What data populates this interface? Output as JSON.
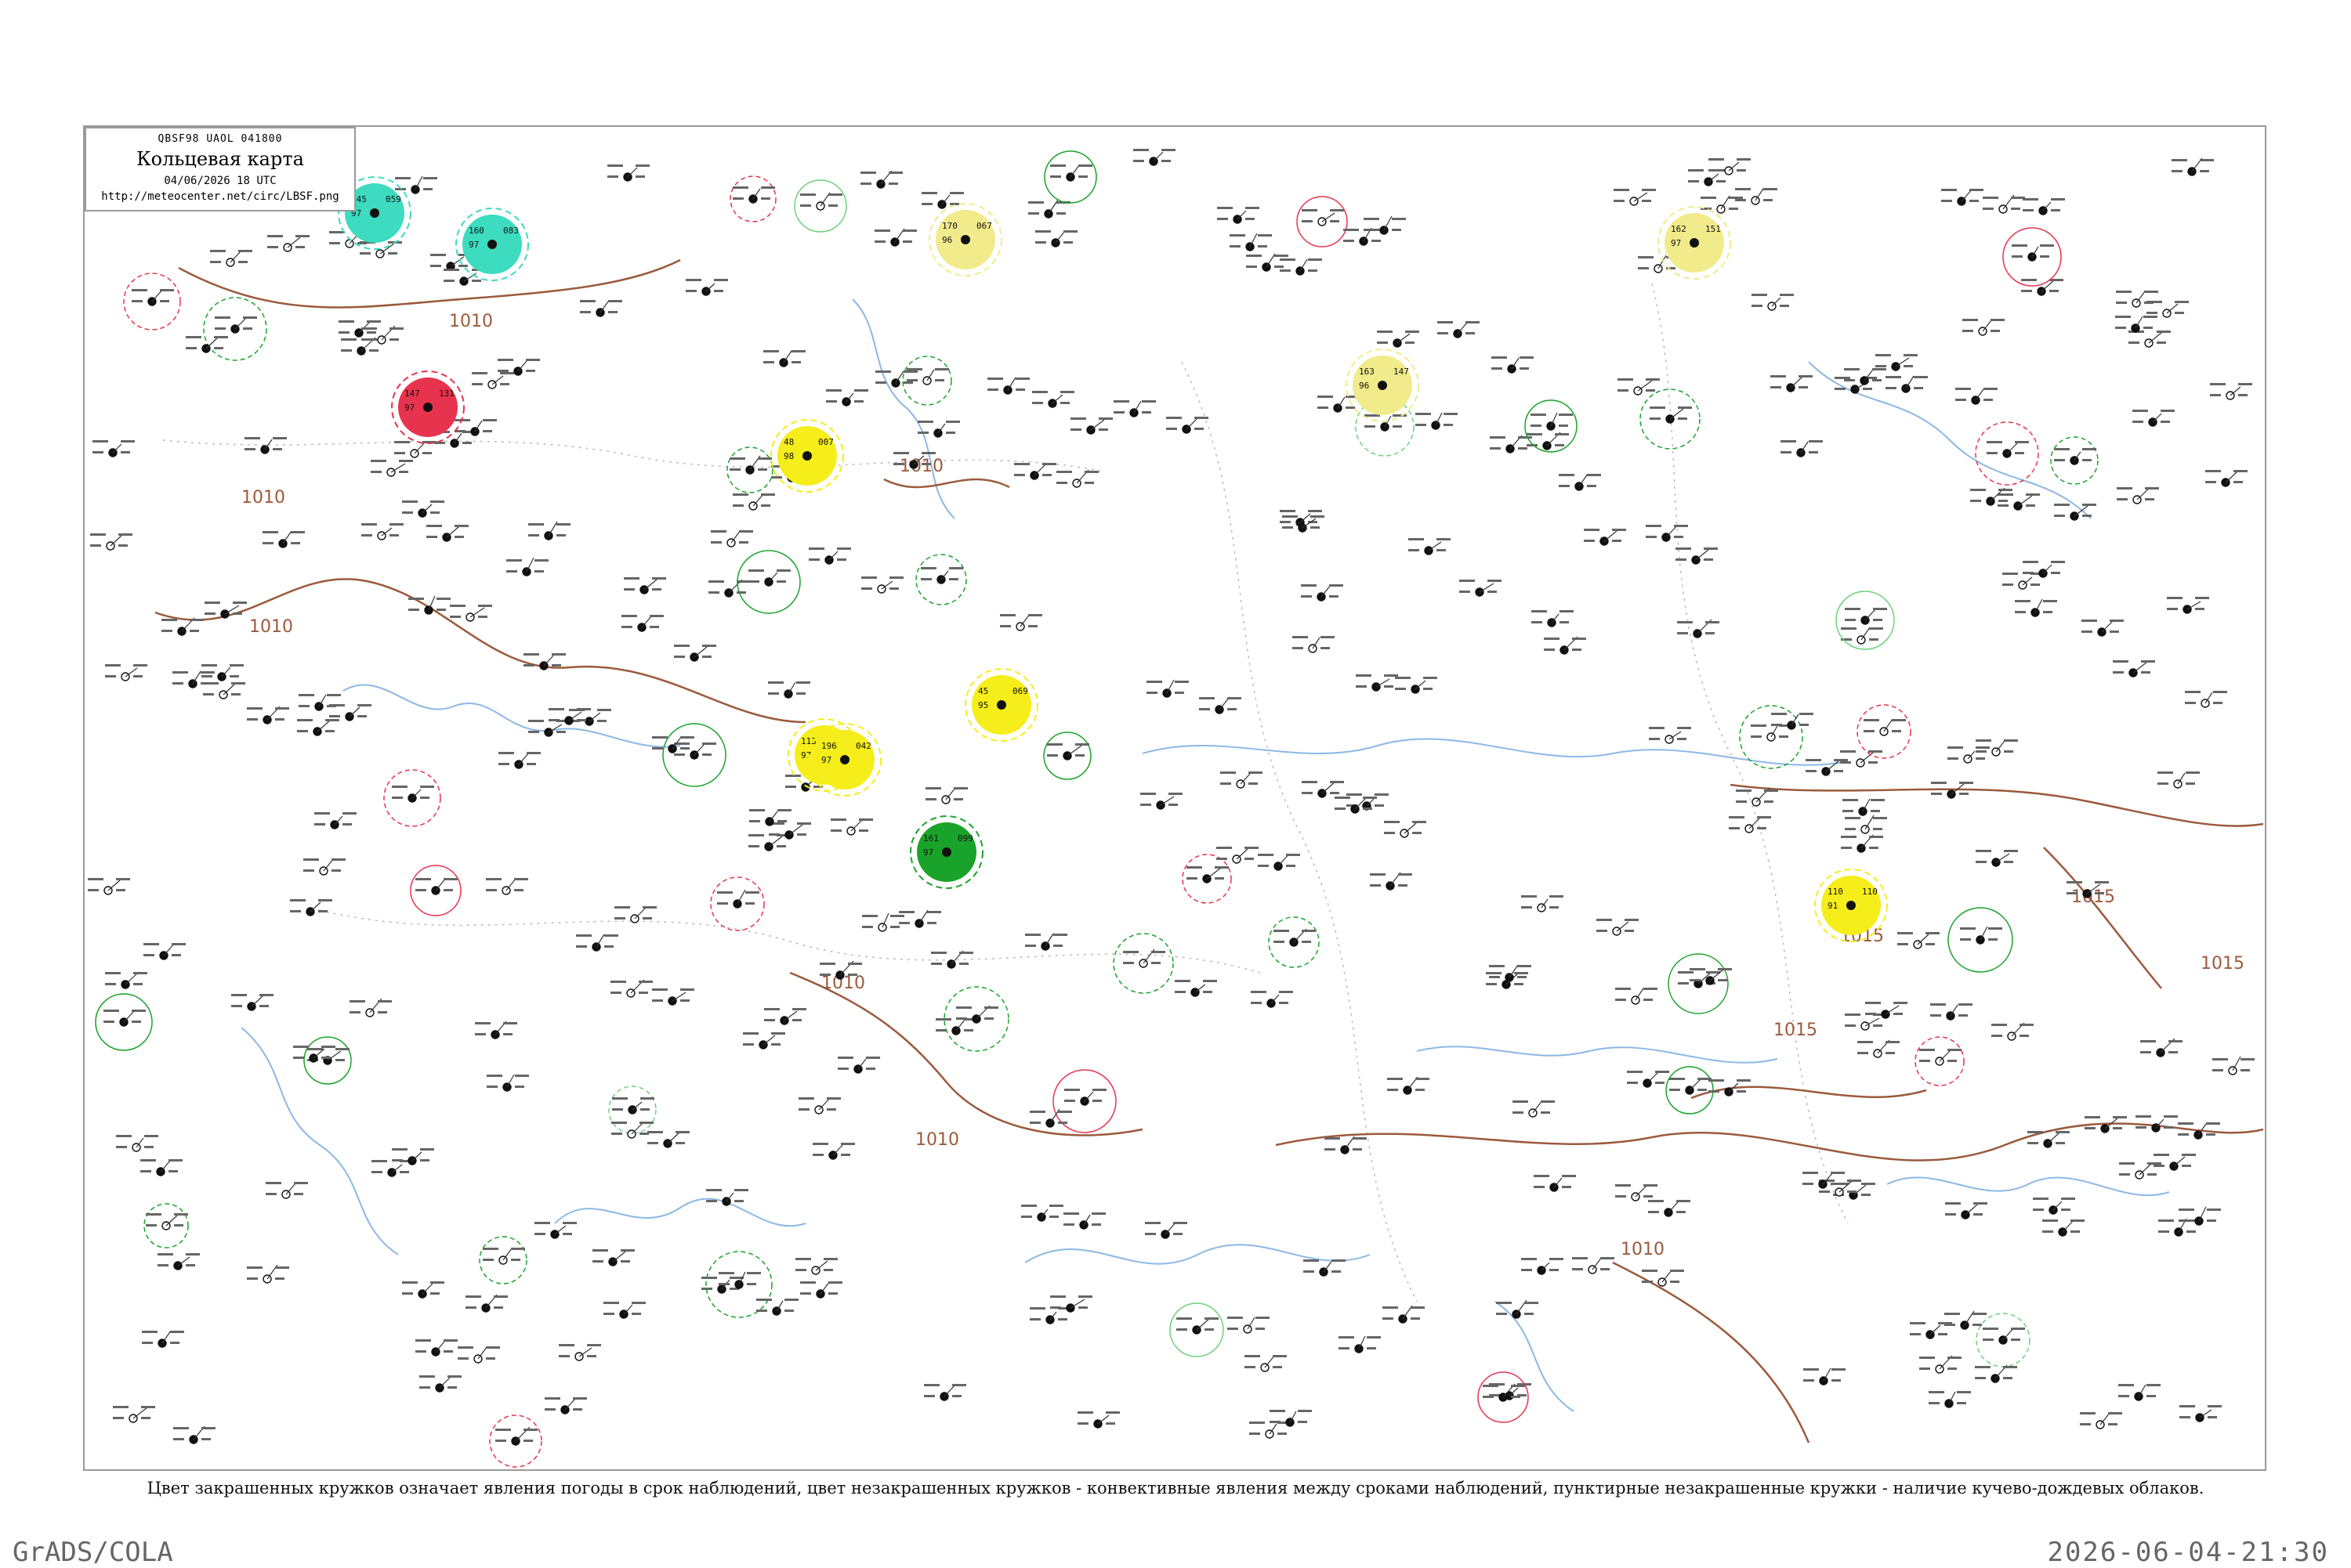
{
  "legend": {
    "code": "QBSF98  UAOL  041800",
    "title": "Кольцевая карта",
    "datetime": "04/06/2026 18 UTC",
    "url": "http://meteocenter.net/circ/LBSF.png"
  },
  "caption": "Цвет закрашенных кружков означает явления погоды в срок наблюдений, цвет незакрашенных кружков - конвективные явления между сроками наблюдений, пунктирные незакрашенные кружки - наличие кучево-дождевых облаков.",
  "footer": {
    "software": "GrADS/COLA",
    "timestamp": "2026-06-04-21:30"
  },
  "colors": {
    "rain": "#1aa32a",
    "drizzle": "#3ddbc0",
    "thunderstorm": "#e8334e",
    "shower": "#f5ee1a",
    "fog": "#f1eb8c",
    "mist": "#6fd17a",
    "isobar": "#9b5a3c",
    "river": "#8cb8e6",
    "border": "#bbbbbb"
  },
  "isobars": [
    {
      "label": "1010",
      "pos": "northwest"
    },
    {
      "label": "1010",
      "pos": "west"
    },
    {
      "label": "1010",
      "pos": "west-central"
    },
    {
      "label": "1010",
      "pos": "north-central"
    },
    {
      "label": "1010",
      "pos": "south-central"
    },
    {
      "label": "1010",
      "pos": "south"
    },
    {
      "label": "1010",
      "pos": "southeast"
    },
    {
      "label": "1015",
      "pos": "east"
    },
    {
      "label": "1015",
      "pos": "east-inner"
    },
    {
      "label": "1015",
      "pos": "southeast-inner"
    },
    {
      "label": "1015",
      "pos": "far-east"
    }
  ],
  "stations": [
    {
      "id": "s1",
      "temp": "145",
      "dew": "97",
      "p": "059",
      "phen": "drizzle"
    },
    {
      "id": "s2",
      "temp": "160",
      "dew": "97",
      "p": "083",
      "phen": "drizzle"
    },
    {
      "id": "s3",
      "temp": "170",
      "dew": "96",
      "p": "067",
      "phen": "fog"
    },
    {
      "id": "s4",
      "temp": "163",
      "dew": "96",
      "p": "147",
      "phen": "fog"
    },
    {
      "id": "s5",
      "temp": "147",
      "dew": "97",
      "p": "131",
      "phen": "thunderstorm"
    },
    {
      "id": "s6",
      "temp": "48",
      "dew": "98",
      "p": "007",
      "phen": "shower"
    },
    {
      "id": "s7",
      "temp": "113",
      "dew": "97",
      "p": "112",
      "phen": "shower"
    },
    {
      "id": "s8",
      "temp": "45",
      "dew": "95",
      "p": "069",
      "phen": "shower"
    },
    {
      "id": "s9",
      "temp": "110",
      "dew": "91",
      "p": "110",
      "phen": "shower"
    },
    {
      "id": "s10",
      "temp": "161",
      "dew": "97",
      "p": "099",
      "phen": "rain"
    },
    {
      "id": "s11",
      "temp": "196",
      "dew": "97",
      "p": "042",
      "phen": "shower"
    },
    {
      "id": "s12",
      "temp": "162",
      "dew": "97",
      "p": "151",
      "phen": "fog"
    }
  ]
}
